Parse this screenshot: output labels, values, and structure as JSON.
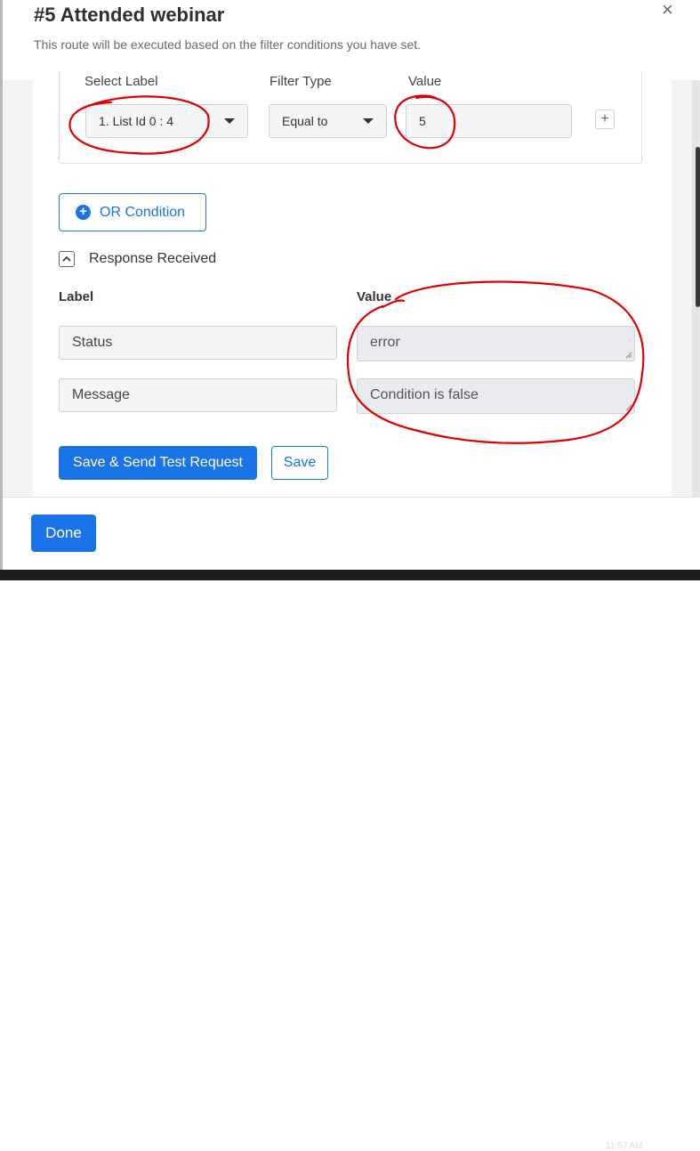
{
  "header": {
    "title": "#5 Attended webinar",
    "subtitle": "This route will be executed based on the filter conditions you have set.",
    "close_glyph": "×"
  },
  "filter": {
    "labels": {
      "select_label": "Select Label",
      "filter_type": "Filter Type",
      "value": "Value"
    },
    "selected_label": "1. List Id 0 : 4",
    "selected_filter_type": "Equal to",
    "value": "5",
    "add_glyph": "+"
  },
  "or_condition": {
    "icon": "plus-circle-icon",
    "label": "OR Condition"
  },
  "response": {
    "title": "Response Received",
    "label_header": "Label",
    "value_header": "Value",
    "rows": [
      {
        "label": "Status",
        "value": "error"
      },
      {
        "label": "Message",
        "value": "Condition is false"
      }
    ]
  },
  "actions": {
    "save_send": "Save & Send Test Request",
    "save": "Save"
  },
  "footer": {
    "done": "Done"
  },
  "taskbar": {
    "time": "11:57 AM"
  },
  "colors": {
    "primary": "#1a73e8",
    "annotation": "#e00000"
  }
}
